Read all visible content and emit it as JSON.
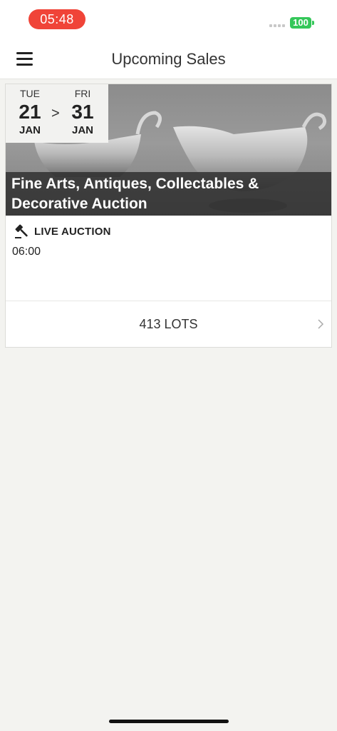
{
  "status_bar": {
    "time": "05:48",
    "battery": "100"
  },
  "nav": {
    "title": "Upcoming Sales"
  },
  "sale": {
    "start": {
      "weekday": "TUE",
      "day": "21",
      "month": "JAN"
    },
    "separator": ">",
    "end": {
      "weekday": "FRI",
      "day": "31",
      "month": "JAN"
    },
    "title": "Fine Arts, Antiques, Collectables & Decorative Auction",
    "auction_type": "LIVE AUCTION",
    "time": "06:00",
    "lots": "413 LOTS"
  },
  "icons": {
    "menu": "hamburger-menu-icon",
    "gavel": "gavel-icon",
    "chevron": "chevron-right-icon"
  },
  "colors": {
    "time_pill": "#f04438",
    "battery": "#34c759",
    "background": "#f3f3f0"
  }
}
